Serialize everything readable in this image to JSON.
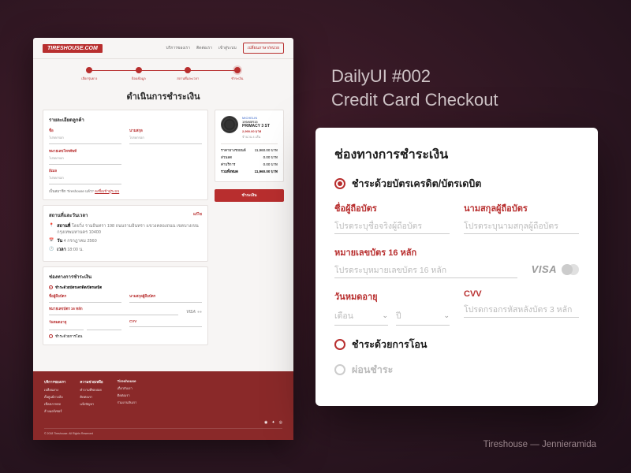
{
  "headline": {
    "l1": "DailyUI #002",
    "l2": "Credit Card Checkout"
  },
  "mockup": {
    "logo": "TIRESHOUSE.COM",
    "nav": [
      "บริการของเรา",
      "ติดต่อเรา",
      "เข้าสู่ระบบ"
    ],
    "nav_cta": "เปลี่ยนภาษา/หน่วย",
    "steps": [
      "เลือกรุ่นยาง",
      "ป้อนข้อมูล",
      "สถานที่และเวลา",
      "ชำระเงิน"
    ],
    "page_title": "ดำเนินการชำระเงิน",
    "customer": {
      "title": "รายละเอียดลูกค้า",
      "fields": {
        "fname": "ชื่อ",
        "lname": "นามสกุล",
        "phone": "หมายเลขโทรศัพท์",
        "email": "อีเมล"
      },
      "member_text": "เป็นสมาชิก Tireshouse แล้ว?",
      "member_link": "ลงชื่อเข้าสู่ระบบ"
    },
    "location": {
      "title": "สถานที่และวันเวลา",
      "edit": "แก้ไข",
      "addr_label": "สถานที่",
      "addr": "โดยวิ่ง รามอินทรา 198 ถนนรามอินทรา แขวงคลองถนน เขตบางเขน กรุงเทพมหานคร 10400",
      "date_label": "วัน",
      "date": "4 กรกฎาคม 2560",
      "time_label": "เวลา",
      "time": "18:00 น."
    },
    "payment": {
      "title": "ช่องทางการชำระเงิน",
      "opt1": "ชำระด้วยบัตรเครดิต/บัตรเดบิต",
      "fname": "ชื่อผู้ถือบัตร",
      "lname": "นามสกุลผู้ถือบัตร",
      "num": "หมายเลขบัตร 16 หลัก",
      "exp": "วันหมดอายุ",
      "cvv": "CVV",
      "opt2": "ชำระด้วยการโอน"
    },
    "product": {
      "brand": "MICHELIN",
      "sku": "195/65R15",
      "name": "PRIMACY 3 ST",
      "price": "2,990.00 บาท",
      "qty": "จำนวน 4 เส้น"
    },
    "summary": {
      "r1l": "ราคายางรถยนต์",
      "r1v": "11,960.00 บาท",
      "r2l": "ส่วนลด",
      "r2v": "0.00 บาท",
      "r3l": "ค่าบริการ",
      "r3v": "0.00 บาท",
      "r4l": "รวมทั้งหมด",
      "r4v": "11,960.00 บาท",
      "btn": "ชำระเงิน"
    },
    "footer": {
      "c1": {
        "h": "บริการของเรา",
        "i": [
          "เปลี่ยนยาง",
          "ตั้งศูนย์ถ่วงล้อ",
          "เช็คสภาพรถ",
          "ล้างแอร์เซอร์"
        ]
      },
      "c2": {
        "h": "ความช่วยเหลือ",
        "i": [
          "คำถามที่พบบ่อย",
          "ติดต่อเรา",
          "แจ้งปัญหา"
        ]
      },
      "c3": {
        "h": "Tireshouse",
        "i": [
          "เกี่ยวกับเรา",
          "ติดต่อเรา",
          "ร่วมงานกับเรา"
        ]
      },
      "copy": "© 2018 Tireshouse. All Rights Reserved"
    }
  },
  "card": {
    "title": "ช่องทางการชำระเงิน",
    "opt_credit": "ชำระด้วยบัตรเครดิต/บัตรเดบิต",
    "fname_lbl": "ชื่อผู้ถือบัตร",
    "fname_ph": "โปรดระบุชื่อจริงผู้ถือบัตร",
    "lname_lbl": "นามสกุลผู้ถือบัตร",
    "lname_ph": "โปรดระบุนามสกุลผู้ถือบัตร",
    "num_lbl": "หมายเลขบัตร 16 หลัก",
    "num_ph": "โปรดระบุหมายเลขบัตร 16 หลัก",
    "exp_lbl": "วันหมดอายุ",
    "month_ph": "เดือน",
    "year_ph": "ปี",
    "cvv_lbl": "CVV",
    "cvv_ph": "โปรดกรอกรหัสหลังบัตร 3 หลัก",
    "opt_transfer": "ชำระด้วยการโอน",
    "opt_install": "ผ่อนชำระ"
  },
  "credit": "Tireshouse  —  Jennieramida"
}
